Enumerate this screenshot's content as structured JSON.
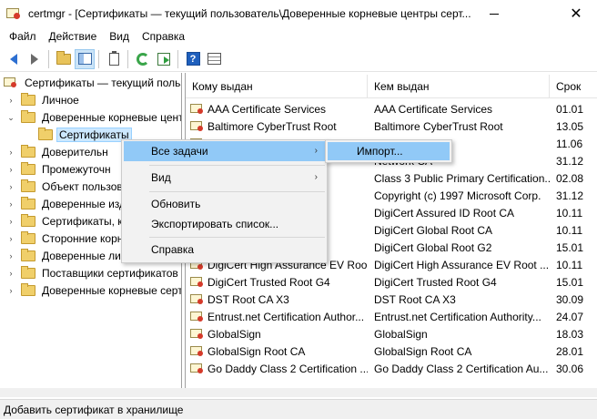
{
  "window": {
    "title": "certmgr - [Сертификаты — текущий пользователь\\Доверенные корневые центры серт...",
    "minimize_glyph": "—",
    "close_glyph": "✕"
  },
  "menubar": [
    "Файл",
    "Действие",
    "Вид",
    "Справка"
  ],
  "toolbar": {
    "icons": [
      "back-arrow-icon",
      "forward-arrow-icon",
      "up-folder-icon",
      "show-hide-console-tree-icon",
      "properties-icon",
      "refresh-icon",
      "export-list-icon",
      "help-icon",
      "details-view-icon"
    ],
    "help_glyph": "?"
  },
  "tree": {
    "root": "Сертификаты — текущий польз",
    "items": [
      {
        "label": "Личное",
        "expandable": true
      },
      {
        "label": "Доверенные корневые цент",
        "expandable": true,
        "expanded": true
      },
      {
        "label": "Сертификаты",
        "child": true,
        "selected": true
      },
      {
        "label": "Доверительн",
        "expandable": true
      },
      {
        "label": "Промежуточн",
        "expandable": true
      },
      {
        "label": "Объект пользов",
        "expandable": true
      },
      {
        "label": "Доверенные изд",
        "expandable": true
      },
      {
        "label": "Сертификаты, к",
        "expandable": true
      },
      {
        "label": "Сторонние корн",
        "expandable": true
      },
      {
        "label": "Доверенные ли",
        "expandable": true
      },
      {
        "label": "Поставщики сертификатов",
        "expandable": true
      },
      {
        "label": "Доверенные корневые серт",
        "expandable": true
      }
    ],
    "collapsed_glyph": "›",
    "expanded_glyph": "⌄"
  },
  "list": {
    "columns": [
      "Кому выдан",
      "Кем выдан",
      "Срок"
    ],
    "rows": [
      {
        "issued_to": "AAA Certificate Services",
        "issued_by": "AAA Certificate Services",
        "expires": "01.01"
      },
      {
        "issued_to": "Baltimore CyberTrust Root",
        "issued_by": "Baltimore CyberTrust Root",
        "expires": "13.05"
      },
      {
        "issued_to": "",
        "issued_by": "",
        "expires": "11.06"
      },
      {
        "issued_to": "",
        "issued_by": "Network CA",
        "expires": "31.12"
      },
      {
        "issued_to": "tificat",
        "issued_by": "Class 3 Public Primary Certification...",
        "expires": "02.08"
      },
      {
        "issued_to": "oft C",
        "issued_by": "Copyright (c) 1997 Microsoft Corp.",
        "expires": "31.12"
      },
      {
        "issued_to": "CA",
        "issued_by": "DigiCert Assured ID Root CA",
        "expires": "10.11"
      },
      {
        "issued_to": "",
        "issued_by": "DigiCert Global Root CA",
        "expires": "10.11"
      },
      {
        "issued_to": "",
        "issued_by": "DigiCert Global Root G2",
        "expires": "15.01"
      },
      {
        "issued_to": "DigiCert High Assurance EV Roo...",
        "issued_by": "DigiCert High Assurance EV Root ...",
        "expires": "10.11"
      },
      {
        "issued_to": "DigiCert Trusted Root G4",
        "issued_by": "DigiCert Trusted Root G4",
        "expires": "15.01"
      },
      {
        "issued_to": "DST Root CA X3",
        "issued_by": "DST Root CA X3",
        "expires": "30.09"
      },
      {
        "issued_to": "Entrust.net Certification Author...",
        "issued_by": "Entrust.net Certification Authority...",
        "expires": "24.07"
      },
      {
        "issued_to": "GlobalSign",
        "issued_by": "GlobalSign",
        "expires": "18.03"
      },
      {
        "issued_to": "GlobalSign Root CA",
        "issued_by": "GlobalSign Root CA",
        "expires": "28.01"
      },
      {
        "issued_to": "Go Daddy Class 2 Certification ...",
        "issued_by": "Go Daddy Class 2 Certification Au...",
        "expires": "30.06"
      }
    ]
  },
  "context_menu": {
    "items": [
      {
        "label": "Все задачи",
        "submenu": true,
        "hover": true
      },
      {
        "label": "Вид",
        "submenu": true
      },
      {
        "label": "Обновить"
      },
      {
        "label": "Экспортировать список..."
      },
      {
        "label": "Справка"
      }
    ],
    "submenu_glyph": "›",
    "submenu": {
      "label": "Импорт..."
    }
  },
  "statusbar": {
    "text": "Добавить сертификат в хранилище"
  },
  "colors": {
    "selection": "#cce8ff",
    "menu_hover": "#91c9f7",
    "menu_bg": "#f2f2f2"
  }
}
